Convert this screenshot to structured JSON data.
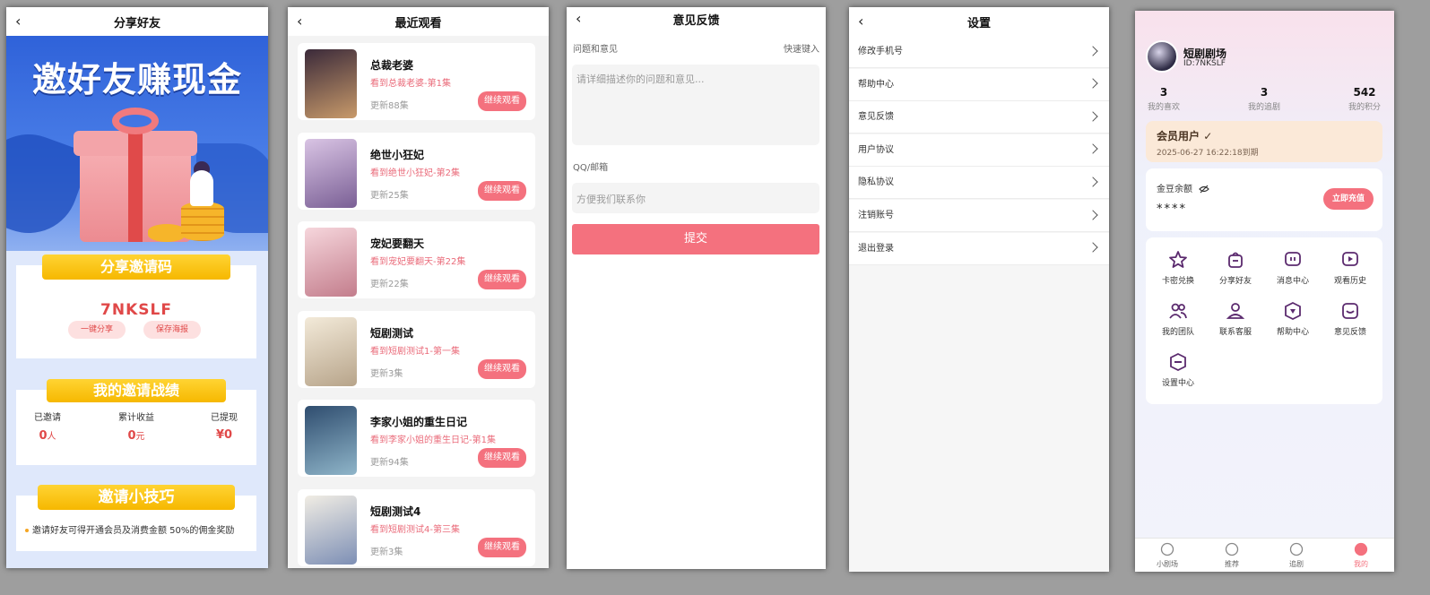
{
  "share": {
    "title": "分享好友",
    "banner_title": "邀好友赚现金",
    "code_section": "分享邀请码",
    "code": "7NKSLF",
    "btn_share": "一键分享",
    "btn_poster": "保存海报",
    "stats_section": "我的邀请战绩",
    "stats": [
      {
        "label": "已邀请",
        "value": "0",
        "unit": "人"
      },
      {
        "label": "累计收益",
        "value": "0",
        "unit": "元"
      },
      {
        "label": "已提现",
        "value": "¥0",
        "unit": ""
      }
    ],
    "tips_section": "邀请小技巧",
    "tip": "邀请好友可得开通会员及消费金额 50%的佣金奖励"
  },
  "recent": {
    "title": "最近观看",
    "button_label": "继续观看",
    "items": [
      {
        "title": "总裁老婆",
        "progress": "看到总裁老婆-第1集",
        "updated": "更新88集",
        "color1": "#3b2a3a",
        "color2": "#c89a6a"
      },
      {
        "title": "绝世小狂妃",
        "progress": "看到绝世小狂妃-第2集",
        "updated": "更新25集",
        "color1": "#d9c4e4",
        "color2": "#7a5f95"
      },
      {
        "title": "宠妃要翻天",
        "progress": "看到宠妃要翻天-第22集",
        "updated": "更新22集",
        "color1": "#f6d6dc",
        "color2": "#c37d8c"
      },
      {
        "title": "短剧测试",
        "progress": "看到短剧测试1-第一集",
        "updated": "更新3集",
        "color1": "#f3ead9",
        "color2": "#b7a48a"
      },
      {
        "title": "李家小姐的重生日记",
        "progress": "看到李家小姐的重生日记-第1集",
        "updated": "更新94集",
        "color1": "#2f4d6f",
        "color2": "#8fb5c9"
      },
      {
        "title": "短剧测试4",
        "progress": "看到短剧测试4-第三集",
        "updated": "更新3集",
        "color1": "#f1ede4",
        "color2": "#7d8fb5"
      }
    ]
  },
  "feedback": {
    "title": "意见反馈",
    "label_issue": "问题和意见",
    "quick": "快速键入",
    "issue_placeholder": "请详细描述你的问题和意见...",
    "label_contact": "QQ/邮箱",
    "contact_placeholder": "方便我们联系你",
    "submit": "提交"
  },
  "settings": {
    "title": "设置",
    "items": [
      "修改手机号",
      "帮助中心",
      "意见反馈",
      "用户协议",
      "隐私协议",
      "注销账号",
      "退出登录"
    ]
  },
  "profile": {
    "name": "短剧剧场",
    "id": "ID:7NKSLF",
    "counts": [
      {
        "value": "3",
        "label": "我的喜欢"
      },
      {
        "value": "3",
        "label": "我的追剧"
      },
      {
        "value": "542",
        "label": "我的积分"
      }
    ],
    "vip_title": "会员用户",
    "vip_date": "2025-06-27 16:22:18到期",
    "balance_label": "金豆余额",
    "balance_hidden": "****",
    "recharge": "立即充值",
    "grid": [
      "卡密兑换",
      "分享好友",
      "消息中心",
      "观看历史",
      "我的团队",
      "联系客服",
      "帮助中心",
      "意见反馈",
      "设置中心"
    ],
    "tabs": [
      "小剧场",
      "推荐",
      "追剧",
      "我的"
    ],
    "accent": "#f4717e",
    "icon_color": "#5b2a6e"
  }
}
